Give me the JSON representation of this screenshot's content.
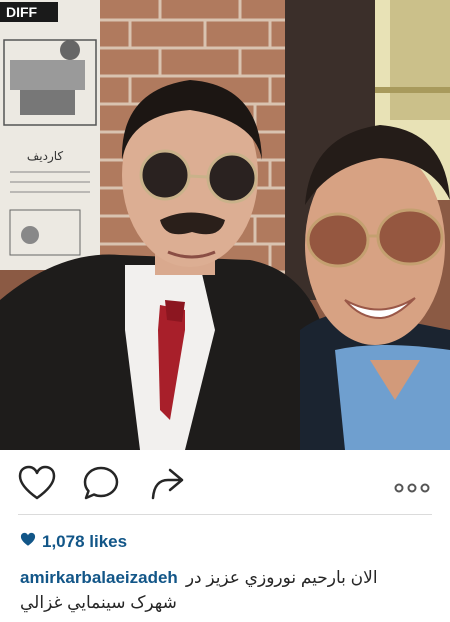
{
  "photo": {
    "alt": "Selfie photo of two men in sunglasses",
    "sign_text": "DIFF",
    "poster_text": "کاردیف"
  },
  "actions": {
    "like_icon": "heart-outline-icon",
    "comment_icon": "speech-bubble-icon",
    "share_icon": "share-arrow-icon",
    "more_icon": "more-dots-icon"
  },
  "likes": {
    "icon": "heart-filled-icon",
    "text": "1,078 likes",
    "color": "#125688"
  },
  "caption": {
    "username": "amirkarbalaeizadeh",
    "line1": "الان بارحیم نوروزي عزیز در",
    "line2": "شهرک سینمایي غزالي"
  }
}
